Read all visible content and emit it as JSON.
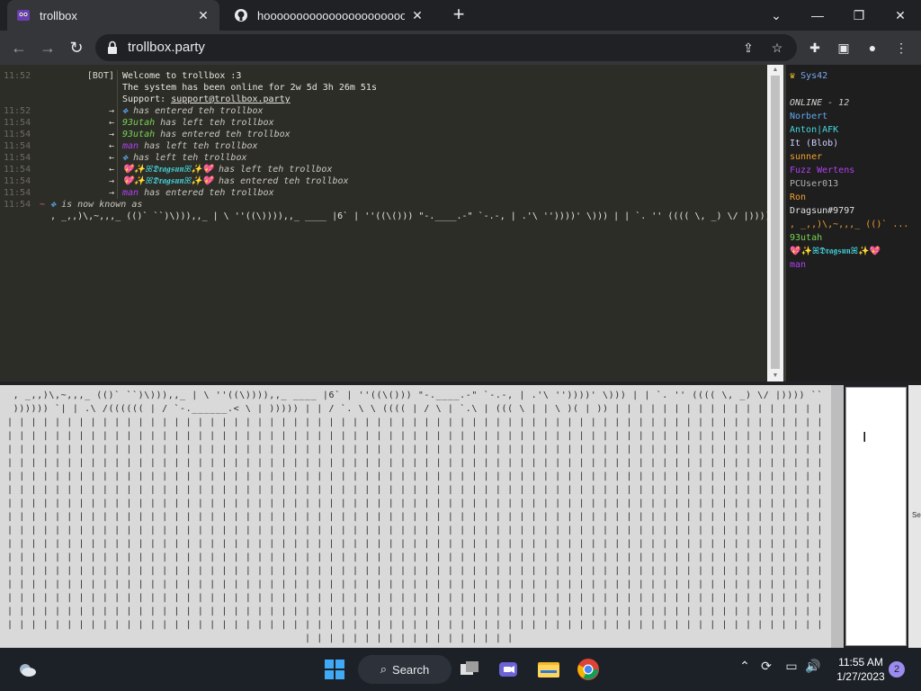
{
  "browser": {
    "tabs": [
      {
        "title": "trollbox",
        "active": true,
        "favicon": "trollbox-favicon"
      },
      {
        "title": "hooooooooooooooooooooooooooooo",
        "active": false,
        "favicon": "github-favicon"
      }
    ],
    "url": "trollbox.party"
  },
  "chat": {
    "messages": [
      {
        "time": "11:52",
        "nick": "[BOT]",
        "text": "Welcome to trollbox :3"
      },
      {
        "time": "",
        "nick": "",
        "text": "The system has been online for 2w 5d 3h 26m 51s"
      },
      {
        "time": "",
        "nick": "",
        "text_prefix": "Support: ",
        "link": "support@trollbox.party"
      },
      {
        "time": "11:52",
        "arrow": "→",
        "user": "",
        "text": "has entered teh trollbox"
      },
      {
        "time": "11:54",
        "arrow": "←",
        "user": "93utah",
        "text": "has left teh trollbox"
      },
      {
        "time": "11:54",
        "arrow": "→",
        "user": "93utah",
        "text": "has entered teh trollbox"
      },
      {
        "time": "11:54",
        "arrow": "←",
        "user": "man",
        "text": "has left teh trollbox"
      },
      {
        "time": "11:54",
        "arrow": "←",
        "user": "",
        "text": "has left teh trollbox"
      },
      {
        "time": "11:54",
        "arrow": "←",
        "user": "💖✨ꕤ𝕯𝖗𝖆𝖌𝖘𝖚𝖓ꕤ✨💖",
        "text": "has left teh trollbox"
      },
      {
        "time": "11:54",
        "arrow": "→",
        "user": "💖✨ꕤ𝕯𝖗𝖆𝖌𝖘𝖚𝖓ꕤ✨💖",
        "text": "has entered teh trollbox"
      },
      {
        "time": "11:54",
        "arrow": "→",
        "user": "man",
        "text": "has entered teh trollbox"
      },
      {
        "time": "11:54",
        "arrow": "~",
        "user": "",
        "text": "is now known as"
      },
      {
        "time": "",
        "nick": "",
        "text": ", _,,)\\,~,,,_ (()` ``)\\))),,_ | \\ ''((\\)))),,_ ____ |6` | ''((\\())) \"-.____.-\" `-.-, | .'\\ ''))))' \\))) | | `. '' (((( \\, _) \\/ |))))"
      }
    ]
  },
  "userlist": {
    "sys_user": "Sys42",
    "online_header": "ONLINE - 12",
    "users": [
      {
        "name": "Norbert",
        "color": "#5fa8f0"
      },
      {
        "name": "Anton|AFK",
        "color": "#44d8e0"
      },
      {
        "name": "It (Blob)",
        "color": "#d0d0ff"
      },
      {
        "name": "sunner",
        "color": "#f0a030"
      },
      {
        "name": "Fuzz Wertens",
        "color": "#b040f0"
      },
      {
        "name": "PCUser013",
        "color": "#b0b0b0"
      },
      {
        "name": "Ron",
        "color": "#f0a030"
      },
      {
        "name": "Dragsun#9797",
        "color": "#e0e0e0"
      },
      {
        "name": ", _,,)\\,~,,,_ (()` ...",
        "color": "#f0a030"
      },
      {
        "name": "93utah",
        "color": "#7ad454"
      },
      {
        "name": "💖✨ꕤ𝕯𝖗𝖆𝖌𝖘𝖚𝖓ꕤ✨💖",
        "color": "#44d8e0"
      },
      {
        "name": "man",
        "color": "#b040f0"
      }
    ]
  },
  "input": {
    "lines": [
      " , _,,)\\,~,,,_ (()` ``)\\))),,_ | \\ ''((\\)))),,_ ____ |6` | ''((\\())) \"-.____.-\" `-.-, | .'\\ ''))))' \\))) | | `. '' (((( \\, _) \\/ |)))) `` | ((((( \\ |",
      " )))))) `| | .\\ /(((((( | / `-.______.< \\ | ))))) | | / `. \\ \\ (((( | / \\ | `.\\ | ((( \\ | | \\ )( | )) | | | | | | | | | | | | | | | | | | | | |",
      "| | | | | | | | | | | | | | | | | | | | | | | | | | | | | | | | | | | | | | | | | | | | | | | | | | | | | | | | | | | | | | | | | | | | | | | | | | |",
      "| | | | | | | | | | | | | | | | | | | | | | | | | | | | | | | | | | | | | | | | | | | | | | | | | | | | | | | | | | | | | | | | | | | | | | | | | | |",
      "| | | | | | | | | | | | | | | | | | | | | | | | | | | | | | | | | | | | | | | | | | | | | | | | | | | | | | | | | | | | | | | | | | | | | | | | | | |",
      "| | | | | | | | | | | | | | | | | | | | | | | | | | | | | | | | | | | | | | | | | | | | | | | | | | | | | | | | | | | | | | | | | | | | | | | | | | |",
      "| | | | | | | | | | | | | | | | | | | | | | | | | | | | | | | | | | | | | | | | | | | | | | | | | | | | | | | | | | | | | | | | | | | | | | | | | | |",
      "| | | | | | | | | | | | | | | | | | | | | | | | | | | | | | | | | | | | | | | | | | | | | | | | | | | | | | | | | | | | | | | | | | | | | | | | | | |",
      "| | | | | | | | | | | | | | | | | | | | | | | | | | | | | | | | | | | | | | | | | | | | | | | | | | | | | | | | | | | | | | | | | | | | | | | | | | |",
      "| | | | | | | | | | | | | | | | | | | | | | | | | | | | | | | | | | | | | | | | | | | | | | | | | | | | | | | | | | | | | | | | | | | | | | | | | | |",
      "| | | | | | | | | | | | | | | | | | | | | | | | | | | | | | | | | | | | | | | | | | | | | | | | | | | | | | | | | | | | | | | | | | | | | | | | | | |",
      "| | | | | | | | | | | | | | | | | | | | | | | | | | | | | | | | | | | | | | | | | | | | | | | | | | | | | | | | | | | | | | | | | | | | | | | | | | |",
      "| | | | | | | | | | | | | | | | | | | | | | | | | | | | | | | | | | | | | | | | | | | | | | | | | | | | | | | | | | | | | | | | | | | | | | | | | | |",
      "| | | | | | | | | | | | | | | | | | | | | | | | | | | | | | | | | | | | | | | | | | | | | | | | | | | | | | | | | | | | | | | | | | | | | | | | | | |",
      "| | | | | | | | | | | | | | | | | | | | | | | | | | | | | | | | | | | | | | | | | | | | | | | | | | | | | | | | | | | | | | | | | | | | | | | | | | |",
      "| | | | | | | | | | | | | | | | | | | | | | | | | | | | | | | | | | | | | | | | | | | | | | | | | | | | | | | | | | | | | | | | | | | | | | | | | | |",
      "| | | | | | | | | | | | | | | | | | | | | | | | | | | | | | | | | | | | | | | | | | | | | | | | | | | | | | | | | | | | | | | | | | | | | | | | | | |",
      "| | | | | | | | | | | | | | | | | | | | | | | | | | | | | | | | | | | | | | | | | | | | | | | | | | | | | | | | | | | | | | | | | | | | | | | | | | |",
      "                                                  | | | | | | | | | | | | | | | | | |"
    ],
    "send_label": "Se"
  },
  "taskbar": {
    "search_label": "Search",
    "time": "11:55 AM",
    "date": "1/27/2023",
    "notifications": "2"
  }
}
